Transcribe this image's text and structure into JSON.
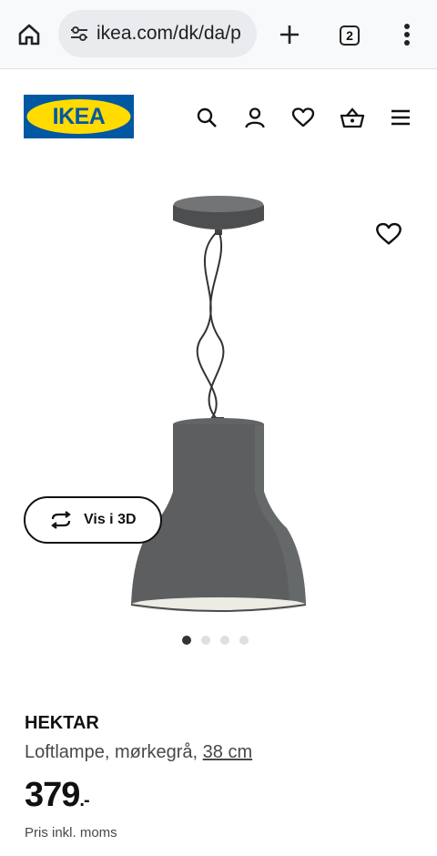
{
  "browser": {
    "url": "ikea.com/dk/da/p",
    "tab_count": "2",
    "icons": [
      "home-icon",
      "site-settings-icon",
      "new-tab-icon",
      "more-vert-icon"
    ]
  },
  "header": {
    "logo_text": "IKEA",
    "icons": [
      "search-icon",
      "account-icon",
      "wishlist-icon",
      "basket-icon",
      "menu-icon"
    ]
  },
  "gallery": {
    "view_3d_label": "Vis i 3D",
    "image_count": 4,
    "active_image": 1
  },
  "product": {
    "name": "HEKTAR",
    "description": "Loftlampe, mørkegrå,",
    "size": "38 cm",
    "price": "379",
    "price_suffix": ".-",
    "price_note": "Pris inkl. moms"
  },
  "colors": {
    "ikea_blue": "#0058A3",
    "ikea_yellow": "#FFDB00",
    "lamp_grey": "#5c5e60"
  }
}
